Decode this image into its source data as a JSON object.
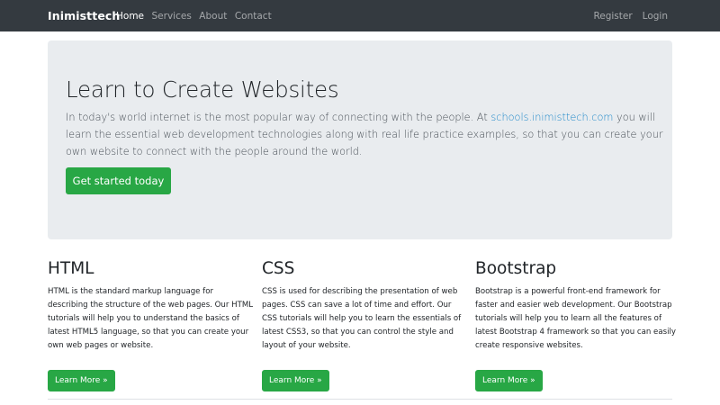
{
  "navbar": {
    "brand": "Inimisttech",
    "left_links": [
      {
        "label": "Home",
        "active": true
      },
      {
        "label": "Services",
        "active": false
      },
      {
        "label": "About",
        "active": false
      },
      {
        "label": "Contact",
        "active": false
      }
    ],
    "right_links": [
      {
        "label": "Register"
      },
      {
        "label": "Login"
      }
    ]
  },
  "jumbotron": {
    "title": "Learn to Create Websites",
    "lead_before": "In today's world internet is the most popular way of connecting with the people. At ",
    "lead_link": "schools.inimisttech.com",
    "lead_after": " you will learn the essential web development technologies along with real life practice examples, so that you can create your own website to connect with the people around the world.",
    "button_label": "Get started today"
  },
  "columns": [
    {
      "heading": "HTML",
      "text": "HTML is the standard markup language for describing the structure of the web pages. Our HTML tutorials will help you to understand the basics of latest HTML5 language, so that you can create your own web pages or website.",
      "button_label": "Learn More »"
    },
    {
      "heading": "CSS",
      "text": "CSS is used for describing the presentation of web pages. CSS can save a lot of time and effort. Our CSS tutorials will help you to learn the essentials of latest CSS3, so that you can control the style and layout of your website.",
      "button_label": "Learn More »"
    },
    {
      "heading": "Bootstrap",
      "text": "Bootstrap is a powerful front-end framework for faster and easier web development. Our Bootstrap tutorials will help you to learn all the features of latest Bootstrap 4 framework so that you can easily create responsive websites.",
      "button_label": "Learn More »"
    }
  ],
  "colors": {
    "navbar_bg": "#343a40",
    "jumbotron_bg": "#e9ecef",
    "button_green": "#28a745",
    "link_blue": "#1e88c9"
  }
}
